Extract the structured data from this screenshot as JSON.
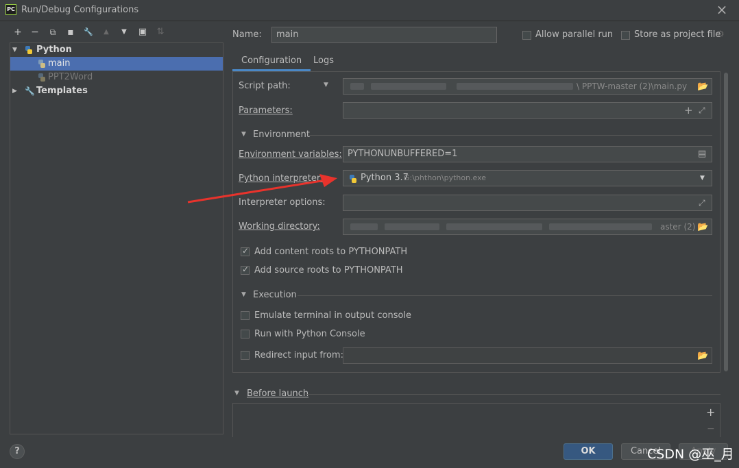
{
  "window": {
    "app_icon_text": "PC",
    "title": "Run/Debug Configurations",
    "close_glyph": "×"
  },
  "toolbar": {
    "icons": [
      "add-icon",
      "remove-icon",
      "copy-icon",
      "save-icon",
      "wrench-icon",
      "move-up-icon",
      "move-down-icon",
      "new-folder-icon",
      "sort-icon"
    ],
    "add": "+",
    "remove": "−",
    "copy": "⧉",
    "save": "▪",
    "wrench": "🔧",
    "up": "▲",
    "down": "▼",
    "folder": "▣",
    "sort": "⇅"
  },
  "tree": {
    "python_group": "Python",
    "item_main": "main",
    "item_ppt2word": "PPT2Word",
    "templates_group": "Templates"
  },
  "header": {
    "name_label": "Name:",
    "name_value": "main",
    "allow_parallel_label": "Allow parallel run",
    "store_project_label": "Store as project file"
  },
  "tabs": [
    {
      "label": "Configuration",
      "active": true
    },
    {
      "label": "Logs",
      "active": false
    }
  ],
  "config": {
    "script_path_label": "Script path:",
    "script_path_value_tail": "\\ PPTW-master (2)\\main.py",
    "parameters_label": "Parameters:",
    "environment_section": "Environment",
    "env_vars_label": "Environment variables:",
    "env_vars_value": "PYTHONUNBUFFERED=1",
    "interpreter_label": "Python interpreter:",
    "interpreter_name": "Python 3.7",
    "interpreter_path": "G:\\phthon\\python.exe",
    "interpreter_options_label": "Interpreter options:",
    "working_dir_label": "Working directory:",
    "working_dir_value_tail": "aster (2)",
    "add_content_roots_label": "Add content roots to PYTHONPATH",
    "add_source_roots_label": "Add source roots to PYTHONPATH",
    "execution_section": "Execution",
    "emulate_terminal_label": "Emulate terminal in output console",
    "run_python_console_label": "Run with Python Console",
    "redirect_input_label": "Redirect input from:",
    "add_content_roots_checked": true,
    "add_source_roots_checked": true,
    "emulate_terminal_checked": false,
    "run_python_console_checked": false,
    "redirect_input_checked": false,
    "allow_parallel_checked": false,
    "store_project_checked": false
  },
  "before_launch": {
    "section": "Before launch",
    "add_glyph": "+",
    "remove_glyph": "−"
  },
  "footer": {
    "help": "?",
    "ok": "OK",
    "cancel": "Cancel",
    "apply": "Apply"
  },
  "watermark": "CSDN @巫_月",
  "colors": {
    "background": "#3c3f41",
    "selection": "#4b6eaf",
    "accent_tab": "#4a88c7",
    "ok_button": "#365880",
    "arrow": "#e8332c"
  }
}
